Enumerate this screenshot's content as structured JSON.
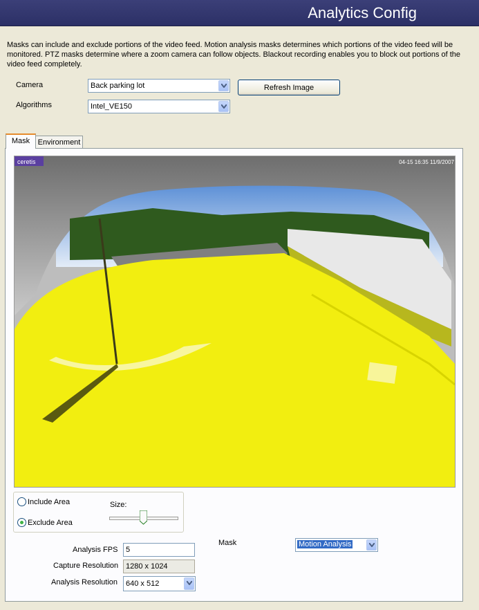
{
  "header": {
    "title": "Analytics Config"
  },
  "description": "Masks can include and exclude portions of the video feed.  Motion analysis masks determines which portions of the video feed will be monitored.  PTZ masks determine where a zoom camera can follow objects.  Blackout recording enables you to block out portions of the video feed completely.",
  "camera": {
    "label": "Camera",
    "value": "Back parking lot"
  },
  "algorithms": {
    "label": "Algorithms",
    "value": "Intel_VE150"
  },
  "refresh_button": "Refresh Image",
  "tabs": [
    {
      "label": "Mask",
      "active": true
    },
    {
      "label": "Environment",
      "active": false
    }
  ],
  "video": {
    "logo_text": "ceretis",
    "timestamp_text": "04-15 16:35 11/9/2007"
  },
  "mask_mode": {
    "include_label": "Include Area",
    "exclude_label": "Exclude Area",
    "selected": "Exclude Area",
    "size_label": "Size:",
    "size_level": 0.5
  },
  "analysis_fps": {
    "label": "Analysis FPS",
    "value": "5"
  },
  "capture_resolution": {
    "label": "Capture Resolution",
    "value": "1280 x 1024"
  },
  "analysis_resolution": {
    "label": "Analysis Resolution",
    "value": "640 x 512"
  },
  "mask_type": {
    "label": "Mask",
    "value": "Motion Analysis"
  },
  "colors": {
    "header": "#2f336b",
    "mask_yellow": "#f2ee10",
    "accent_tab": "#e68b2c"
  }
}
